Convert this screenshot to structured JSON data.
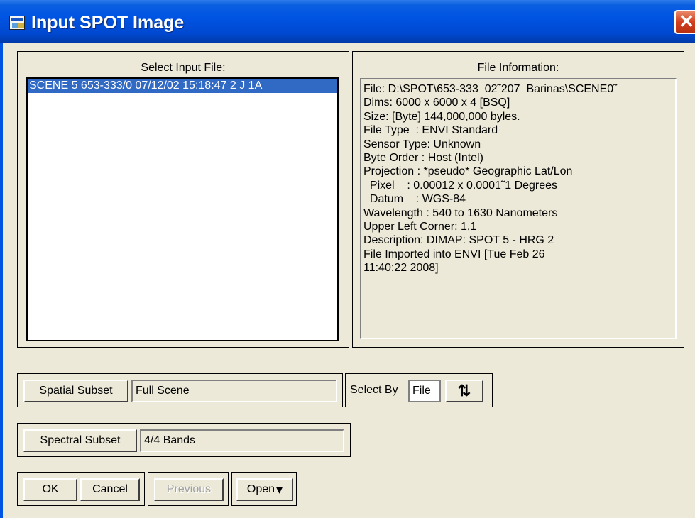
{
  "window": {
    "title": "Input SPOT Image",
    "close_glyph": "✕"
  },
  "input_panel": {
    "title": "Select Input File:",
    "items": [
      {
        "label": "SCENE 5 653-333/0 07/12/02 15:18:47 2 J 1A",
        "selected": true
      }
    ]
  },
  "info_panel": {
    "title": "File Information:",
    "lines": [
      "File: D:\\SPOT\\653-333_02˜207_Barinas\\SCENE0˜",
      "Dims: 6000 x 6000 x 4 [BSQ]",
      "Size: [Byte] 144,000,000 byles.",
      "File Type  : ENVI Standard",
      "Sensor Type: Unknown",
      "Byte Order : Host (Intel)",
      "Projection : *pseudo* Geographic Lat/Lon",
      "  Pixel    : 0.00012 x 0.0001˜1 Degrees",
      "  Datum    : WGS-84",
      "Wavelength : 540 to 1630 Nanometers",
      "Upper Left Corner: 1,1",
      "Description: DIMAP: SPOT 5 - HRG 2",
      "File Imported into ENVI [Tue Feb 26",
      "11:40:22 2008]"
    ]
  },
  "spatial": {
    "button": "Spatial Subset",
    "value": "Full Scene"
  },
  "select_by": {
    "label": "Select By",
    "value": "File",
    "sort_icon": "sort-toggle-icon",
    "sort_glyph": "⇅"
  },
  "spectral": {
    "button": "Spectral Subset",
    "value": "4/4 Bands"
  },
  "actions": {
    "ok": "OK",
    "cancel": "Cancel",
    "previous": "Previous",
    "open": "Open",
    "open_arrow": "▾"
  },
  "colors": {
    "titlebar": "#0054e3",
    "selection": "#316ac5",
    "close": "#d2401e"
  }
}
